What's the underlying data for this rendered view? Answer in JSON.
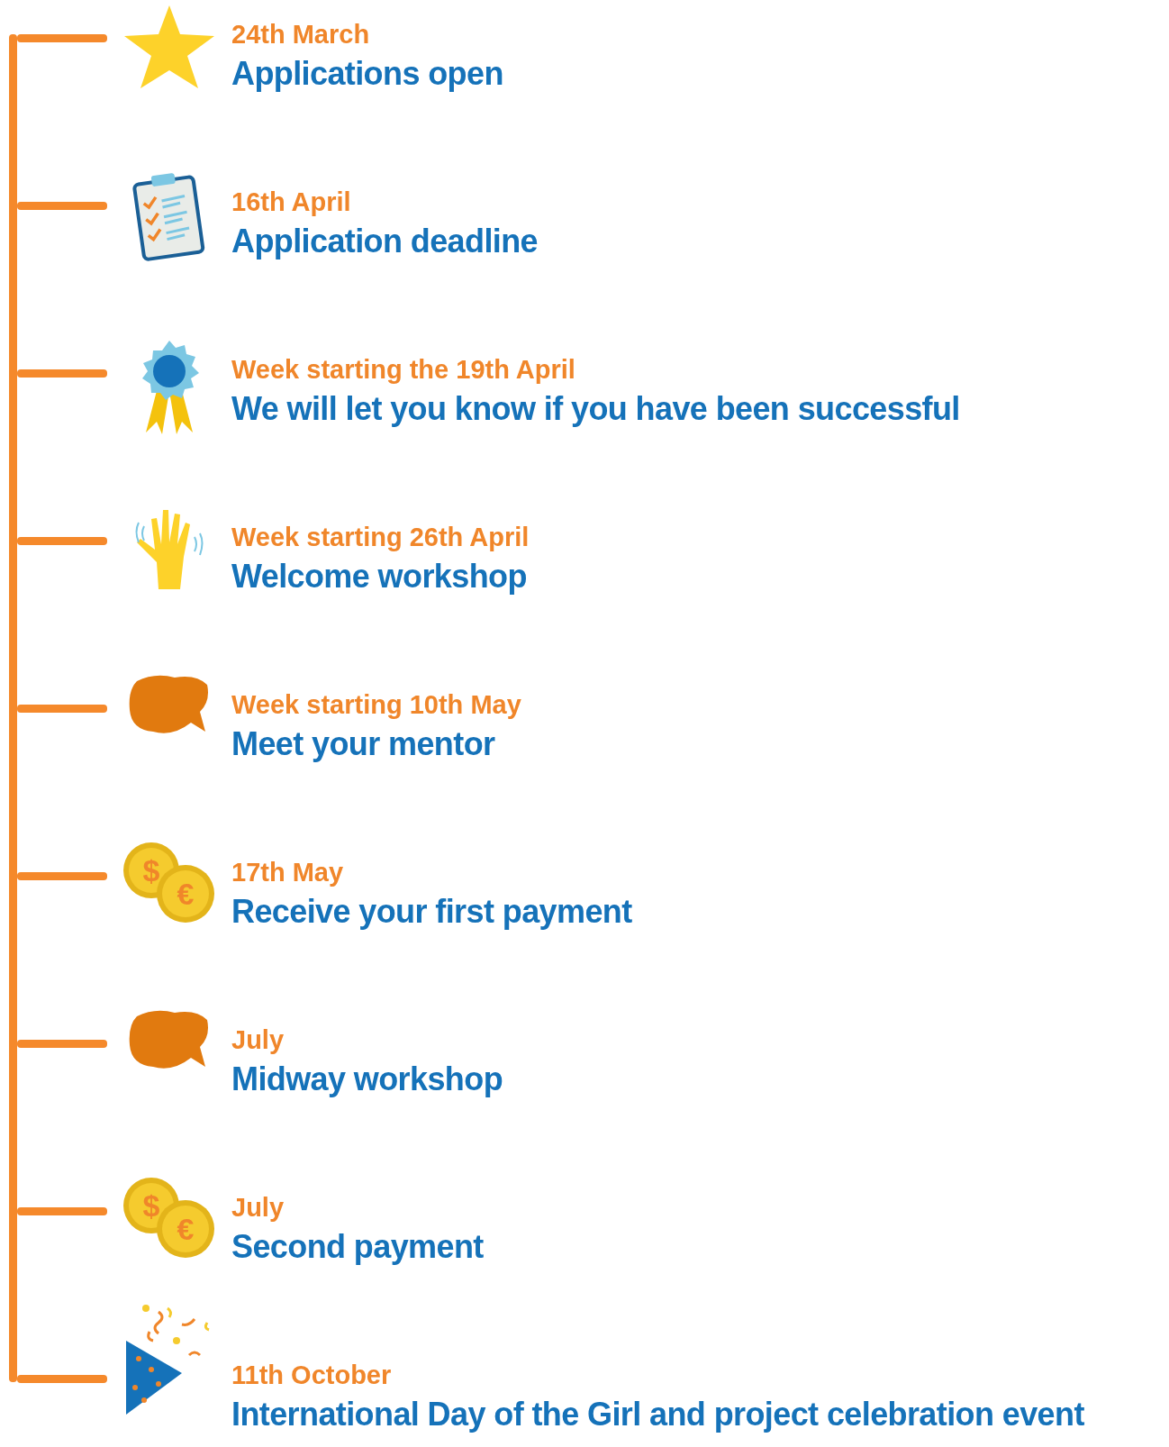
{
  "milestones": [
    {
      "kind": "star",
      "date": "24th March",
      "title": "Applications open"
    },
    {
      "kind": "clipboard",
      "date": "16th April",
      "title": "Application deadline"
    },
    {
      "kind": "rosette",
      "date": "Week starting the 19th April",
      "title": "We will let you know if you have been successful"
    },
    {
      "kind": "hand",
      "date": "Week starting 26th April",
      "title": "Welcome workshop"
    },
    {
      "kind": "speech",
      "date": "Week starting 10th May",
      "title": "Meet your mentor"
    },
    {
      "kind": "coins",
      "coin_symbols": [
        "$",
        "€"
      ],
      "date": "17th May",
      "title": "Receive your first payment"
    },
    {
      "kind": "speech",
      "date": "July",
      "title": "Midway workshop"
    },
    {
      "kind": "coins",
      "coin_symbols": [
        "$",
        "€"
      ],
      "date": "July",
      "title": "Second payment"
    },
    {
      "kind": "party",
      "date": "11th October",
      "title": "International Day of the Girl and project celebration event"
    }
  ]
}
